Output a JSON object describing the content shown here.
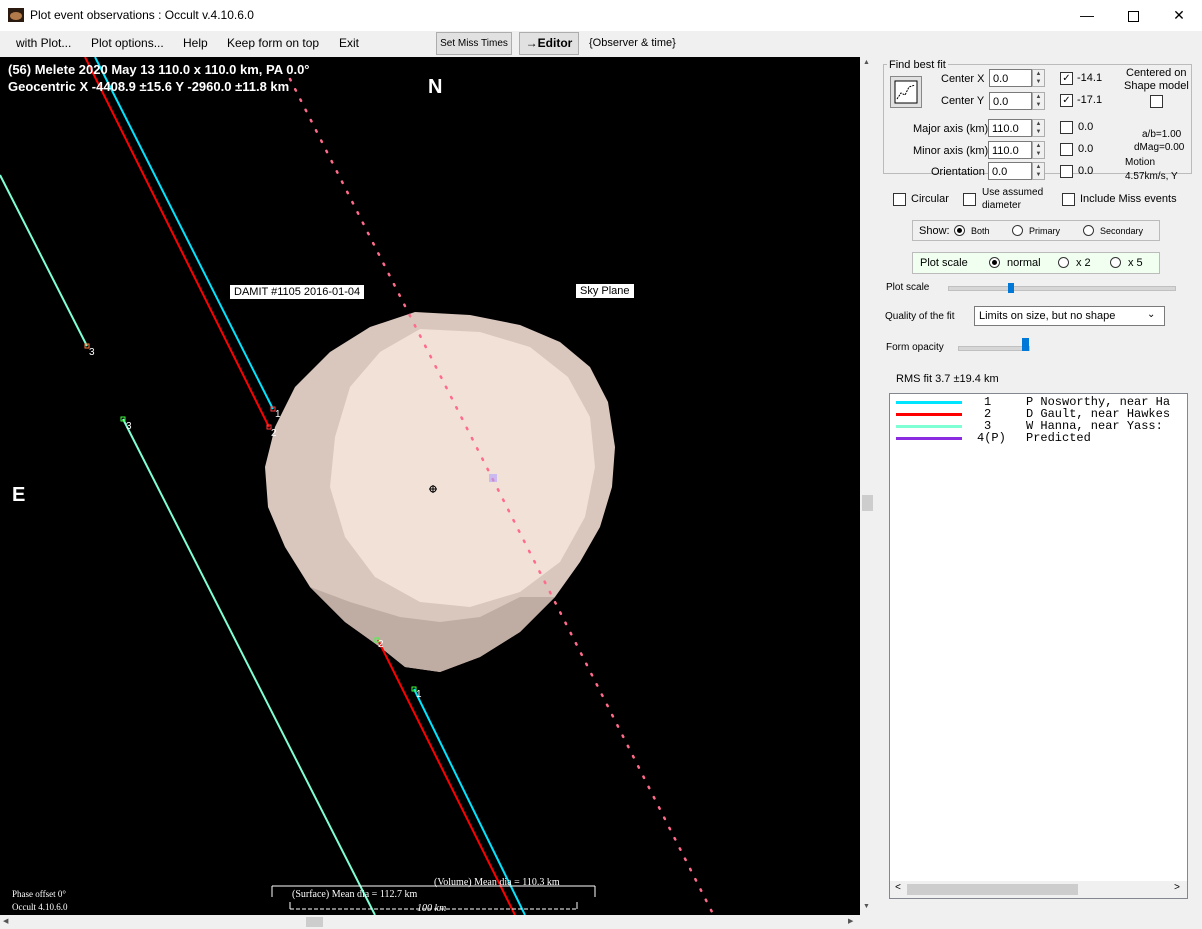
{
  "window": {
    "title": "Plot event observations : Occult v.4.10.6.0",
    "icons": [
      "app-asteroid-icon",
      "minimize-icon",
      "maximize-icon",
      "close-icon"
    ]
  },
  "menu": {
    "items": [
      "with Plot...",
      "Plot options...",
      "Help",
      "Keep form on top",
      "Exit"
    ],
    "set_miss_times": "Set Miss Times",
    "editor": "→Editor",
    "observer_time": "{Observer & time}"
  },
  "plot": {
    "header_line1": "(56) Melete  2020 May 13  110.0 x 110.0 km, PA 0.0°",
    "header_line2": "Geocentric  X  -4408.9 ±15.6  Y -2960.0 ±11.8 km",
    "north": "N",
    "east": "E",
    "damit_label": "DAMIT #1105 2016-01-04",
    "sky_plane": "Sky Plane",
    "volume_mean": "(Volume) Mean dia = 110.3 km",
    "surface_mean": "(Surface) Mean dia = 112.7 km",
    "scale_bar": "100 km",
    "phase_offset": "Phase offset 0°",
    "occult_version": "Occult 4.10.6.0",
    "chord_labels": [
      "1",
      "2",
      "3",
      "3",
      "1",
      "2"
    ],
    "colors": {
      "chord1": "#00e5ff",
      "chord2": "#ff0000",
      "chord3": "#7fffd4",
      "predicted": "#ff6b8a",
      "shape": "#e8d8d0"
    }
  },
  "panel": {
    "find_best_fit": "Find best fit",
    "center_x_label": "Center X",
    "center_x_value": "0.0",
    "center_x_result": "-14.1",
    "center_y_label": "Center Y",
    "center_y_value": "0.0",
    "center_y_result": "-17.1",
    "centered_on": "Centered on",
    "shape_model": "Shape model",
    "major_label": "Major axis (km)",
    "major_value": "110.0",
    "major_result": "0.0",
    "minor_label": "Minor axis (km)",
    "minor_value": "110.0",
    "minor_result": "0.0",
    "orient_label": "Orientation",
    "orient_value": "0.0",
    "orient_result": "0.0",
    "ab_ratio": "a/b=1.00",
    "dmag": "dMag=0.00",
    "motion_label": "Motion",
    "motion_value": "4.57km/s, Y",
    "circular": "Circular",
    "use_assumed_1": "Use assumed",
    "use_assumed_2": "diameter",
    "include_miss": "Include Miss events",
    "show_label": "Show:",
    "show_both": "Both",
    "show_primary": "Primary",
    "show_secondary": "Secondary",
    "plot_scale_box": "Plot scale",
    "scale_normal": "normal",
    "scale_x2": "x 2",
    "scale_x5": "x 5",
    "plot_scale_slider": "Plot scale",
    "quality_label": "Quality of the fit",
    "quality_value": "Limits on size, but no shape",
    "form_opacity": "Form opacity",
    "rms_fit": "RMS fit 3.7 ±19.4 km",
    "slider_plot_scale": 0.28,
    "slider_opacity": 0.95
  },
  "legend": [
    {
      "num": "1",
      "name": "P Nosworthy, near Ha",
      "color": "#00e5ff"
    },
    {
      "num": "2",
      "name": "D Gault, near Hawkes",
      "color": "#ff0000"
    },
    {
      "num": "3",
      "name": "W Hanna, near Yass:",
      "color": "#7fffd4"
    },
    {
      "num": "4(P)",
      "name": "Predicted",
      "color": "#8a2be2"
    }
  ]
}
